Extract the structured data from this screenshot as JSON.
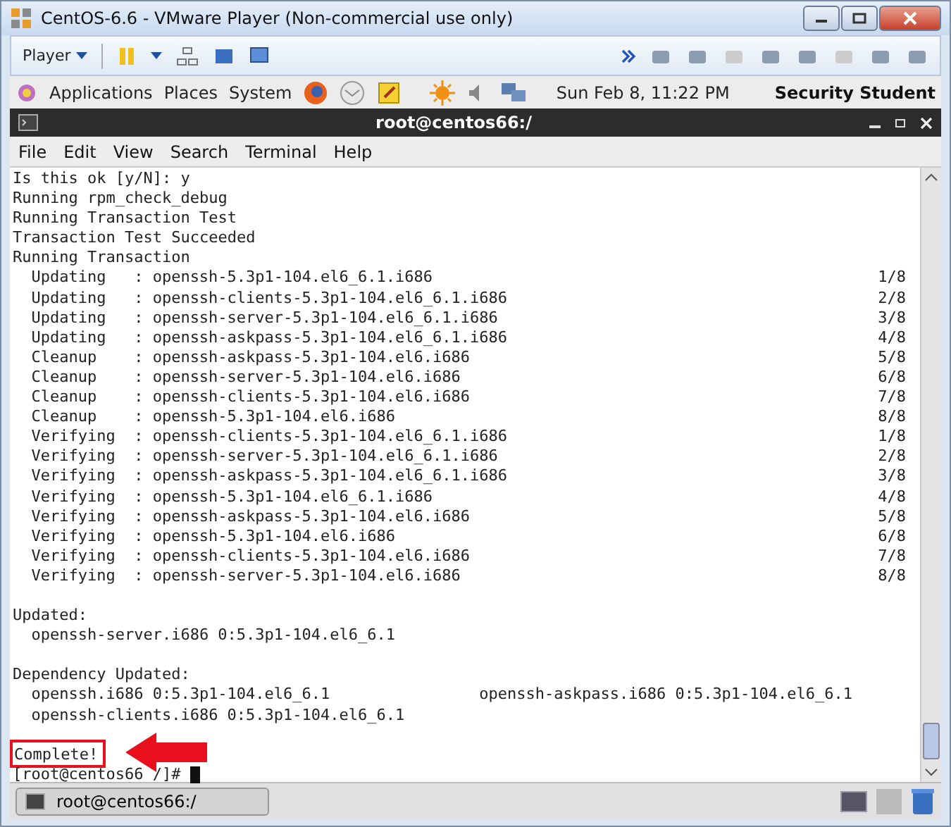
{
  "window": {
    "title": "CentOS-6.6 - VMware Player (Non-commercial use only)"
  },
  "player_toolbar": {
    "menu": "Player"
  },
  "gnome_panel": {
    "menus": [
      "Applications",
      "Places",
      "System"
    ],
    "clock": "Sun Feb  8, 11:22 PM",
    "user": "Security Student"
  },
  "terminal": {
    "title": "root@centos66:/",
    "menu": [
      "File",
      "Edit",
      "View",
      "Search",
      "Terminal",
      "Help"
    ],
    "lines": [
      {
        "kind": "text",
        "text": "Is this ok [y/N]: y"
      },
      {
        "kind": "text",
        "text": "Running rpm_check_debug"
      },
      {
        "kind": "text",
        "text": "Running Transaction Test"
      },
      {
        "kind": "text",
        "text": "Transaction Test Succeeded"
      },
      {
        "kind": "text",
        "text": "Running Transaction"
      },
      {
        "kind": "step",
        "action": "Updating",
        "package": ": openssh-5.3p1-104.el6_6.1.i686",
        "count": "1/8"
      },
      {
        "kind": "step",
        "action": "Updating",
        "package": ": openssh-clients-5.3p1-104.el6_6.1.i686",
        "count": "2/8"
      },
      {
        "kind": "step",
        "action": "Updating",
        "package": ": openssh-server-5.3p1-104.el6_6.1.i686",
        "count": "3/8"
      },
      {
        "kind": "step",
        "action": "Updating",
        "package": ": openssh-askpass-5.3p1-104.el6_6.1.i686",
        "count": "4/8"
      },
      {
        "kind": "step",
        "action": "Cleanup",
        "package": ": openssh-askpass-5.3p1-104.el6.i686",
        "count": "5/8"
      },
      {
        "kind": "step",
        "action": "Cleanup",
        "package": ": openssh-server-5.3p1-104.el6.i686",
        "count": "6/8"
      },
      {
        "kind": "step",
        "action": "Cleanup",
        "package": ": openssh-clients-5.3p1-104.el6.i686",
        "count": "7/8"
      },
      {
        "kind": "step",
        "action": "Cleanup",
        "package": ": openssh-5.3p1-104.el6.i686",
        "count": "8/8"
      },
      {
        "kind": "step",
        "action": "Verifying",
        "package": ": openssh-clients-5.3p1-104.el6_6.1.i686",
        "count": "1/8"
      },
      {
        "kind": "step",
        "action": "Verifying",
        "package": ": openssh-server-5.3p1-104.el6_6.1.i686",
        "count": "2/8"
      },
      {
        "kind": "step",
        "action": "Verifying",
        "package": ": openssh-askpass-5.3p1-104.el6_6.1.i686",
        "count": "3/8"
      },
      {
        "kind": "step",
        "action": "Verifying",
        "package": ": openssh-5.3p1-104.el6_6.1.i686",
        "count": "4/8"
      },
      {
        "kind": "step",
        "action": "Verifying",
        "package": ": openssh-askpass-5.3p1-104.el6.i686",
        "count": "5/8"
      },
      {
        "kind": "step",
        "action": "Verifying",
        "package": ": openssh-5.3p1-104.el6.i686",
        "count": "6/8"
      },
      {
        "kind": "step",
        "action": "Verifying",
        "package": ": openssh-clients-5.3p1-104.el6.i686",
        "count": "7/8"
      },
      {
        "kind": "step",
        "action": "Verifying",
        "package": ": openssh-server-5.3p1-104.el6.i686",
        "count": "8/8"
      },
      {
        "kind": "blank"
      },
      {
        "kind": "text",
        "text": "Updated:"
      },
      {
        "kind": "indent",
        "text": "openssh-server.i686 0:5.3p1-104.el6_6.1"
      },
      {
        "kind": "blank"
      },
      {
        "kind": "text",
        "text": "Dependency Updated:"
      },
      {
        "kind": "pair",
        "left": "openssh.i686 0:5.3p1-104.el6_6.1",
        "right": "openssh-askpass.i686 0:5.3p1-104.el6_6.1"
      },
      {
        "kind": "indent",
        "text": "openssh-clients.i686 0:5.3p1-104.el6_6.1"
      },
      {
        "kind": "blank"
      },
      {
        "kind": "highlight",
        "text": "Complete!"
      },
      {
        "kind": "prompt",
        "text": "[root@centos66 /]#"
      }
    ]
  },
  "taskbar": {
    "items": [
      {
        "label": "root@centos66:/",
        "selected": false
      }
    ]
  }
}
